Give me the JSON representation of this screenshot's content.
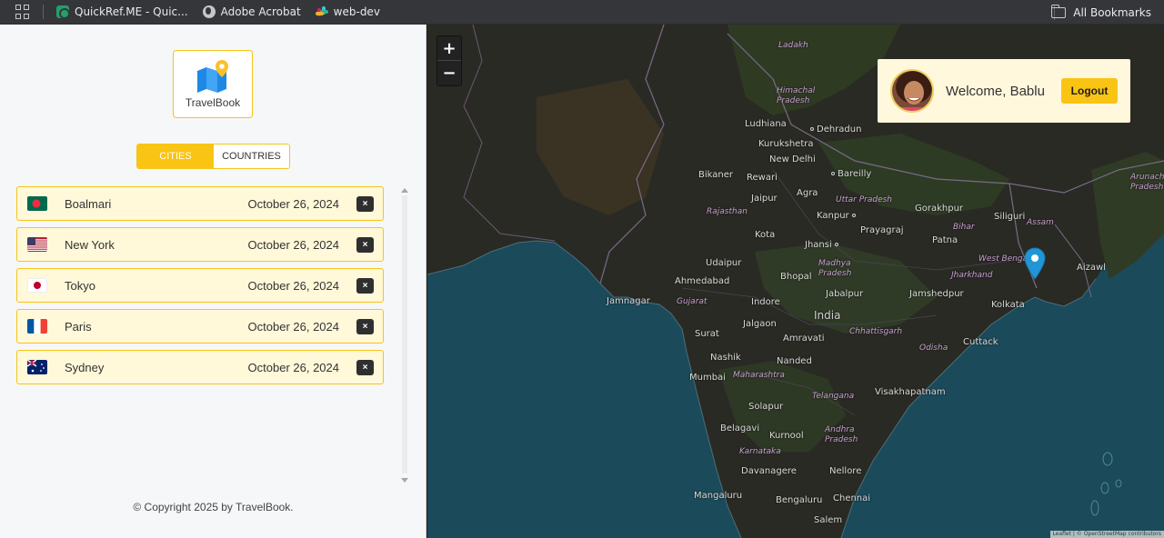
{
  "bookmarks": {
    "items": [
      {
        "label": "QuickRef.ME - Quic...",
        "icon": "quickref-icon"
      },
      {
        "label": "Adobe Acrobat",
        "icon": "globe-icon"
      },
      {
        "label": "web-dev",
        "icon": "slack-icon"
      }
    ],
    "all_bookmarks": "All Bookmarks"
  },
  "sidebar": {
    "logo_text": "TravelBook",
    "tabs": [
      {
        "label": "CITIES",
        "active": true
      },
      {
        "label": "COUNTRIES",
        "active": false
      }
    ],
    "cities": [
      {
        "name": "Boalmari",
        "date": "October 26, 2024",
        "flag": "bangladesh"
      },
      {
        "name": "New York",
        "date": "October 26, 2024",
        "flag": "usa"
      },
      {
        "name": "Tokyo",
        "date": "October 26, 2024",
        "flag": "japan"
      },
      {
        "name": "Paris",
        "date": "October 26, 2024",
        "flag": "france"
      },
      {
        "name": "Sydney",
        "date": "October 26, 2024",
        "flag": "australia"
      }
    ],
    "delete_label": "×",
    "copyright": "© Copyright 2025 by TravelBook."
  },
  "map": {
    "zoom_in": "+",
    "zoom_out": "−",
    "user": {
      "welcome": "Welcome, Bablu",
      "logout": "Logout"
    },
    "attribution": "Leaflet | © OpenStreetMap contributors",
    "labels": {
      "cities": [
        "Ludhiana",
        "Dehradun",
        "Kurukshetra",
        "New Delhi",
        "Bikaner",
        "Rewari",
        "Agra",
        "Bareilly",
        "Jaipur",
        "Kanpur",
        "Prayagraj",
        "Gorakhpur",
        "Patna",
        "Siliguri",
        "Kota",
        "Jhansi",
        "Udaipur",
        "Ahmedabad",
        "Bhopal",
        "Jabalpur",
        "Jamshedpur",
        "Kolkata",
        "Jamnagar",
        "Indore",
        "Surat",
        "Jalgaon",
        "Amravati",
        "Nashik",
        "Nanded",
        "Cuttack",
        "Mumbai",
        "Visakhapatnam",
        "Solapur",
        "Belagavi",
        "Kurnool",
        "Davanagere",
        "Nellore",
        "Mangaluru",
        "Bengaluru",
        "Chennai",
        "Salem",
        "Aizawl"
      ],
      "states": [
        "Ladakh",
        "Himachal Pradesh",
        "Uttar Pradesh",
        "Rajasthan",
        "Bihar",
        "Assam",
        "Madhya Pradesh",
        "West Bengal",
        "Jharkhand",
        "Gujarat",
        "Chhattisgarh",
        "Odisha",
        "Maharashtra",
        "Telangana",
        "Andhra Pradesh",
        "Karnataka",
        "Arunachal Pradesh"
      ],
      "countries": [
        "India"
      ]
    }
  },
  "colors": {
    "accent": "#f9c413",
    "item_bg": "#fff8d9",
    "map_water": "#1a4a5c",
    "map_land": "#2b2b26",
    "marker": "#2196d6"
  }
}
